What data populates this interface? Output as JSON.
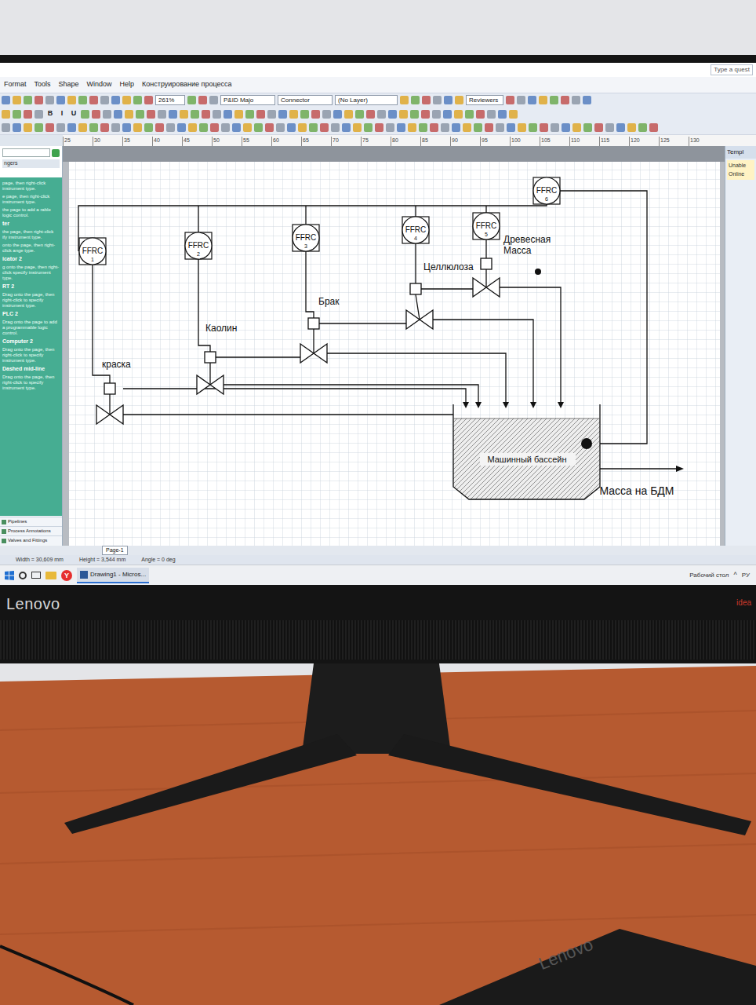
{
  "window": {
    "help_search": "Type a quest"
  },
  "menu": [
    {
      "label": "Format"
    },
    {
      "label": "Tools"
    },
    {
      "label": "Shape"
    },
    {
      "label": "Window"
    },
    {
      "label": "Help"
    },
    {
      "label": "Конструирование процесса"
    }
  ],
  "toolbar": {
    "zoom": "261%",
    "connector_shape": "P&ID Majo",
    "connector": "Connector",
    "layer": "(No Layer)",
    "reviewers": "Reviewers",
    "format_buttons": [
      "B",
      "I",
      "U"
    ]
  },
  "ruler": [
    "25",
    "30",
    "35",
    "40",
    "45",
    "50",
    "55",
    "60",
    "65",
    "70",
    "75",
    "80",
    "85",
    "90",
    "95",
    "100",
    "105",
    "110",
    "115",
    "120",
    "125",
    "130"
  ],
  "shapes_panel": {
    "header": "ngers",
    "items": [
      {
        "text": "page, then right-click instrument type.",
        "heading": false
      },
      {
        "text": "e page, then right-click instrument type.",
        "heading": false
      },
      {
        "text": "the page to add a rable logic control.",
        "heading": false
      },
      {
        "text": "ter",
        "heading": true
      },
      {
        "text": "the page, then right-click ify instrument type.",
        "heading": false
      },
      {
        "text": "onto the page, then right-click ange type.",
        "heading": false
      },
      {
        "text": "icator 2",
        "heading": true
      },
      {
        "text": "g onto the page, then right-click specify instrument type.",
        "heading": false
      },
      {
        "text": "RT 2",
        "heading": true
      },
      {
        "text": "Drag onto the page, then right-click to specify instrument type.",
        "heading": false
      },
      {
        "text": "PLC 2",
        "heading": true
      },
      {
        "text": "Drag onto the page to add a programmable logic control.",
        "heading": false
      },
      {
        "text": "Computer 2",
        "heading": true
      },
      {
        "text": "Drag onto the page, then right-click to specify instrument type.",
        "heading": false
      },
      {
        "text": "Dashed mid-line",
        "heading": true
      },
      {
        "text": "Drag onto the page, then right-click to specify instrument type.",
        "heading": false
      }
    ],
    "stencils": [
      "Pipelines",
      "Process Annotations",
      "Valves and Fittings"
    ]
  },
  "diagram": {
    "instruments": [
      {
        "label": "FFRC",
        "number": "1"
      },
      {
        "label": "FFRC",
        "number": "2"
      },
      {
        "label": "FFRC",
        "number": "3"
      },
      {
        "label": "FFRC",
        "number": "4"
      },
      {
        "label": "FFRC",
        "number": "5"
      },
      {
        "label": "FFRC",
        "number": "6"
      }
    ],
    "feeds": [
      {
        "label": "краска"
      },
      {
        "label": "Каолин"
      },
      {
        "label": "Брак"
      },
      {
        "label": "Целлюлоза"
      },
      {
        "label": "Древесная Масса"
      }
    ],
    "tank": {
      "label": "Машинный бассейн"
    },
    "output": {
      "label": "Масса на БДМ"
    }
  },
  "page_tabs": [
    {
      "label": "Page-1",
      "selected": true
    }
  ],
  "status_bar": {
    "width": "Width = 30,609 mm",
    "height": "Height = 3,544 mm",
    "angle": "Angle = 0 deg"
  },
  "task_pane": {
    "title": "Templ",
    "notice": [
      "Unable",
      "Online"
    ]
  },
  "taskbar": {
    "yandex": "Y",
    "apps": [
      {
        "label": "Drawing1 - Micros...",
        "active": true
      }
    ],
    "desktop": "Рабочий стол",
    "caret": "^",
    "language": "РУ"
  },
  "monitor": {
    "brand": "Lenovo",
    "series": "idea"
  },
  "keyboard": {
    "brand": "Lenovo"
  }
}
